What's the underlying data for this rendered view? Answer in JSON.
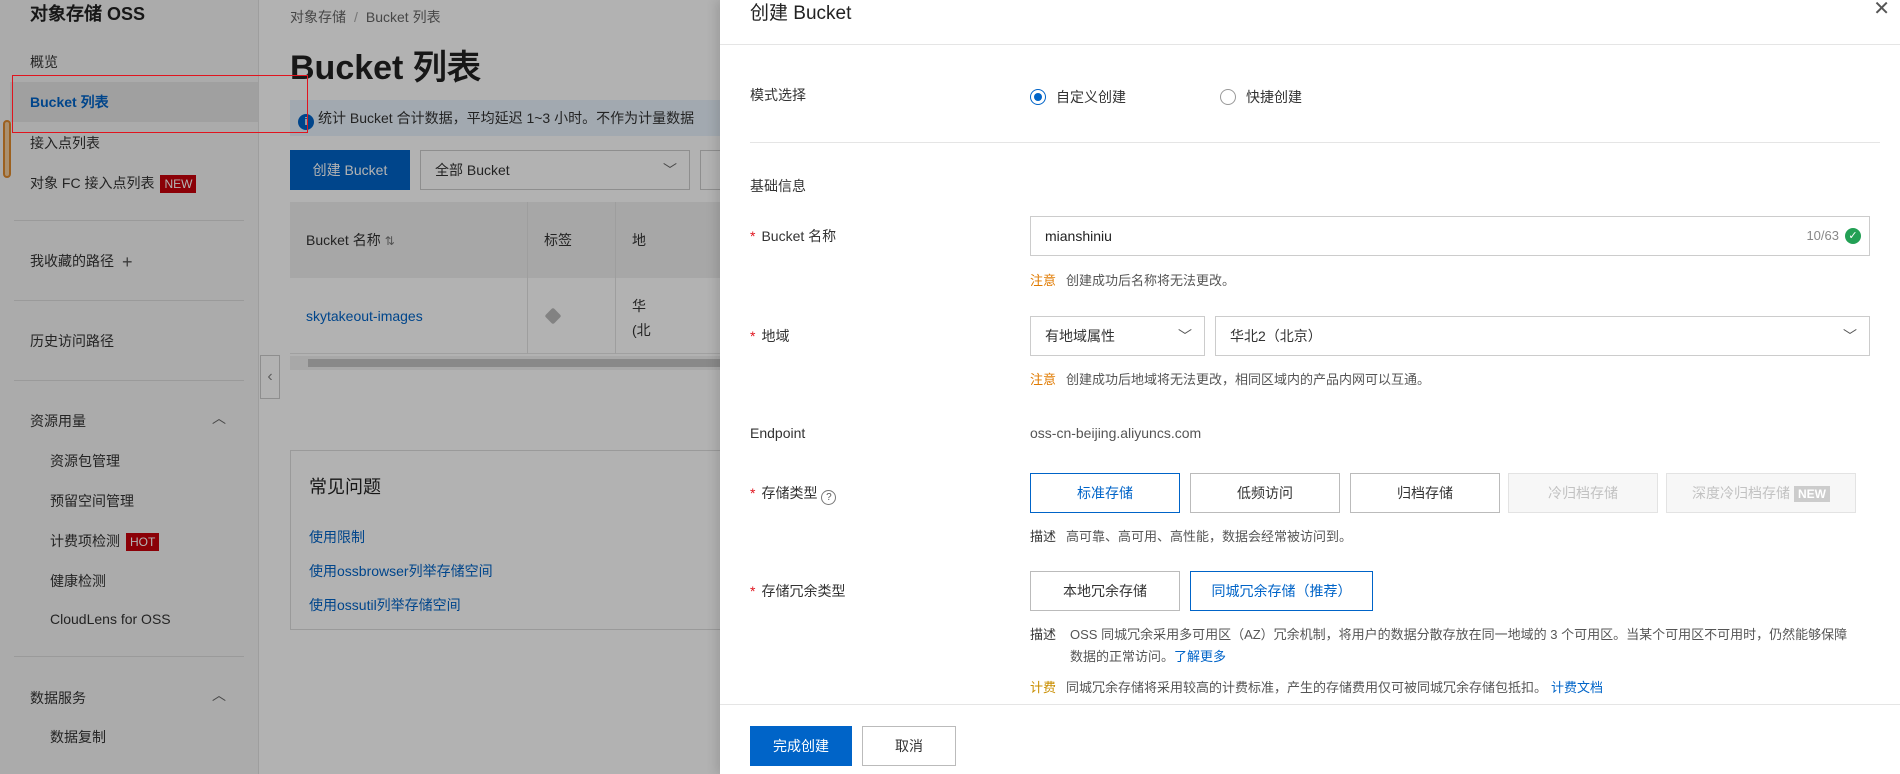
{
  "sidebar": {
    "title": "对象存储 OSS",
    "items": {
      "overview": "概览",
      "bucket_list": "Bucket 列表",
      "access_points": "接入点列表",
      "fc_access_points": "对象 FC 接入点列表",
      "fc_badge": "NEW",
      "favorites": "我收藏的路径",
      "history": "历史访问路径",
      "resource_usage": "资源用量",
      "resource_pkg": "资源包管理",
      "reserved_space": "预留空间管理",
      "billing_check": "计费项检测",
      "billing_badge": "HOT",
      "health_check": "健康检测",
      "cloudlens": "CloudLens for OSS",
      "data_service": "数据服务",
      "data_copy": "数据复制"
    }
  },
  "main": {
    "breadcrumb": [
      "对象存储",
      "Bucket 列表"
    ],
    "title": "Bucket 列表",
    "notice": "统计 Bucket 合计数据，平均延迟 1~3 小时。不作为计量数据",
    "create_button": "创建 Bucket",
    "filter_select": "全部 Bucket",
    "table": {
      "headers": [
        "Bucket 名称",
        "标签",
        "地"
      ],
      "rows": [
        {
          "name": "skytakeout-images",
          "region_line1": "华",
          "region_line2": "(北"
        }
      ]
    },
    "faq": {
      "title": "常见问题",
      "links": [
        "使用限制",
        "使用ossbrowser列举存储空间",
        "使用ossutil列举存储空间"
      ]
    }
  },
  "drawer": {
    "title": "创建 Bucket",
    "mode": {
      "label": "模式选择",
      "options": [
        "自定义创建",
        "快捷创建"
      ],
      "selected": "自定义创建"
    },
    "basic_info": "基础信息",
    "bucket_name": {
      "label": "Bucket 名称",
      "value": "mianshiniu",
      "counter": "10/63",
      "hint_key": "注意",
      "hint": "创建成功后名称将无法更改。"
    },
    "region": {
      "label": "地域",
      "attr_select": "有地域属性",
      "region_select": "华北2（北京）",
      "hint_key": "注意",
      "hint": "创建成功后地域将无法更改，相同区域内的产品内网可以互通。"
    },
    "endpoint": {
      "label": "Endpoint",
      "value": "oss-cn-beijing.aliyuncs.com"
    },
    "storage_class": {
      "label": "存储类型",
      "options": [
        "标准存储",
        "低频访问",
        "归档存储",
        "冷归档存储",
        "深度冷归档存储"
      ],
      "new_tag": "NEW",
      "selected": "标准存储",
      "desc_key": "描述",
      "desc": "高可靠、高可用、高性能，数据会经常被访问到。"
    },
    "redundancy": {
      "label": "存储冗余类型",
      "options": [
        "本地冗余存储",
        "同城冗余存储（推荐）"
      ],
      "selected": "同城冗余存储（推荐）",
      "desc_key": "描述",
      "desc": "OSS 同城冗余采用多可用区（AZ）冗余机制，将用户的数据分散存放在同一地域的 3 个可用区。当某个可用区不可用时，仍然能够保障数据的正常访问。",
      "learn_more": "了解更多",
      "bill_key": "计费",
      "bill": "同城冗余存储将采用较高的计费标准，产生的存储费用仅可被同城冗余存储包抵扣。",
      "bill_link": "计费文档"
    },
    "footer": {
      "confirm": "完成创建",
      "cancel": "取消"
    }
  }
}
